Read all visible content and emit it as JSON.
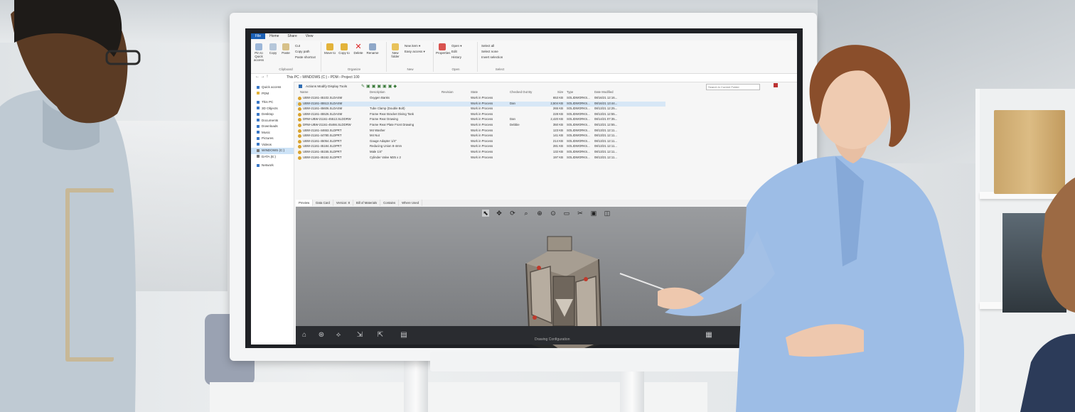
{
  "ribbon": {
    "tabs": [
      "File",
      "Home",
      "Share",
      "View"
    ],
    "clipboard": {
      "pin": "Pin to Quick access",
      "copy": "Copy",
      "paste": "Paste",
      "cut": "Cut",
      "copy_path": "Copy path",
      "paste_shortcut": "Paste shortcut",
      "label": "Clipboard"
    },
    "organize": {
      "move_to": "Move to",
      "copy_to": "Copy to",
      "delete": "Delete",
      "rename": "Rename",
      "label": "Organize"
    },
    "new": {
      "new_folder": "New folder",
      "new_item": "New item ▾",
      "easy_access": "Easy access ▾",
      "label": "New"
    },
    "open": {
      "properties": "Properties",
      "open": "Open ▾",
      "edit": "Edit",
      "history": "History",
      "label": "Open"
    },
    "select": {
      "select_all": "Select all",
      "select_none": "Select none",
      "invert": "Invert selection",
      "label": "Select"
    }
  },
  "address": {
    "path": "This PC  ›  WINDOWS (C:)  ›  PDM  ›  Project 100"
  },
  "sidebar": {
    "items": [
      "Quick access",
      "PDM",
      "This PC",
      "3D Objects",
      "Desktop",
      "Documents",
      "Downloads",
      "Music",
      "Pictures",
      "Videos",
      "WINDOWS (C:)",
      "DATA (E:)",
      "Network"
    ]
  },
  "pdm_toolbar": {
    "menu": "Actions  Modify  Display  Tools",
    "search_placeholder": "Search in Current Folder"
  },
  "files": {
    "columns": [
      "Name",
      "Description",
      "Revision",
      "State",
      "Checked Out By",
      "Size",
      "Type",
      "Date Modified"
    ],
    "rows": [
      [
        "UBW-21161-45102.SLDASM",
        "Oxygen Banks",
        "",
        "Work in Process",
        "",
        "653 KB",
        "SOLIDWORKS...",
        "08/16/21 12:16..."
      ],
      [
        "UBW-21161-45513.SLDASM",
        "",
        "",
        "Work in Process",
        "Dan",
        "2,504 KB",
        "SOLIDWORKS...",
        "08/16/21 13:44..."
      ],
      [
        "UBW-21161-45606.SLDASM",
        "Tube Clamp (Double Bolt)",
        "",
        "Work in Process",
        "",
        "265 KB",
        "SOLIDWORKS...",
        "08/13/21 12:25..."
      ],
      [
        "UBW-21161-45526.SLDASM",
        "Frame Rear Bracket Diving Tank",
        "",
        "Work in Process",
        "",
        "228 KB",
        "SOLIDWORKS...",
        "08/13/21 12:55..."
      ],
      [
        "DRW-UBW-21161-45513.SLDDRW",
        "Frame Rear Drawing",
        "",
        "Work in Process",
        "Dan",
        "2,420 KB",
        "SOLIDWORKS...",
        "08/14/21 07:35..."
      ],
      [
        "DRW-UBW-21161-45466.SLDDRW",
        "Frame Rear Plate Front Drawing",
        "",
        "Work in Process",
        "Debbie",
        "350 KB",
        "SOLIDWORKS...",
        "08/13/21 12:55..."
      ],
      [
        "UBW-21161-44653.SLDPRT",
        "M4 Washer",
        "",
        "Work in Process",
        "",
        "123 KB",
        "SOLIDWORKS...",
        "08/13/21 12:11..."
      ],
      [
        "UBW-21161-44780.SLDPRT",
        "M4 Nut",
        "",
        "Work in Process",
        "",
        "141 KB",
        "SOLIDWORKS...",
        "08/13/21 12:11..."
      ],
      [
        "UBW-21161-45054.SLDPRT",
        "Gauge Adapter 1/4\"",
        "",
        "Work in Process",
        "",
        "214 KB",
        "SOLIDWORKS...",
        "08/13/21 12:11..."
      ],
      [
        "UBW-21161-45184.SLDPRT",
        "Reducing Union 8-4mm",
        "",
        "Work in Process",
        "",
        "281 KB",
        "SOLIDWORKS...",
        "08/13/21 12:11..."
      ],
      [
        "UBW-21161-45155.SLDPRT",
        "Male 1/4\"",
        "",
        "Work in Process",
        "",
        "132 KB",
        "SOLIDWORKS...",
        "08/13/21 12:11..."
      ],
      [
        "UBW-21161-45162.SLDPRT",
        "Cylinder Valve M25 x 2",
        "",
        "Work in Process",
        "",
        "197 KB",
        "SOLIDWORKS...",
        "08/13/21 12:11..."
      ]
    ]
  },
  "preview_tabs": [
    "Preview",
    "Data Card",
    "Version: 8",
    "Bill of Materials",
    "Contains",
    "Where Used"
  ],
  "viewer": {
    "config_label": "Drawing Configuration"
  },
  "colors": {
    "accent": "#1a5fb4",
    "folder": "#d9a32f",
    "viewport": "#8a8c8f"
  }
}
